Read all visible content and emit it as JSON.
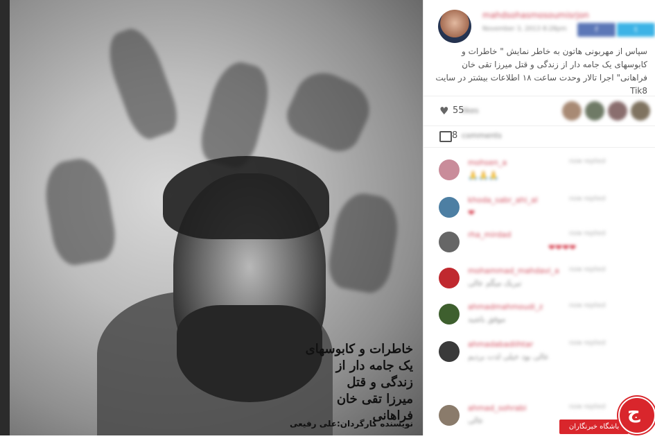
{
  "poster": {
    "title_lines": [
      "خاطرات و کابوسهای",
      "یک جامه دار از زندگی و قتل",
      "میرزا تقی خان فراهانی"
    ],
    "credit": "نویسنده کارگردان:علی رفیعی"
  },
  "post": {
    "username": "mahdsohasmosoumisrjon",
    "date": "November 3, 2013 8:28pm",
    "share_facebook": "f",
    "share_twitter": "t",
    "caption": "سپاس از مهربونی هاتون به خاطر نمایش \" خاطرات و کابوسهای یک جامه دار از زندگی و قتل میرزا تقی خان فراهانی\" اجرا تالار وحدت ساعت ۱۸ اطلاعات بیشتر در سایت Tik8",
    "likes_count": "55",
    "likes_label": "likes",
    "comments_count": "8",
    "comments_label": "comments"
  },
  "comments": [
    {
      "user": "mohsen_a",
      "time": "now replied",
      "text": "🙏🙏🙏",
      "avatar_color": "#c98c9a"
    },
    {
      "user": "khoda_sabr_ahi_al",
      "time": "now replied",
      "text": "❤",
      "avatar_color": "#4d7fa3"
    },
    {
      "user": "rha_mirdad",
      "time": "now replied",
      "text": "❤❤❤❤",
      "avatar_color": "#666666"
    },
    {
      "user": "mohammad_mahdavi_a",
      "time": "now replied",
      "text": "تبریک میگم عالی",
      "avatar_color": "#c0292f"
    },
    {
      "user": "ahmadmahmoudi_z",
      "time": "now replied",
      "text": "موفق باشید",
      "avatar_color": "#3e5f2e"
    },
    {
      "user": "ahmadabadiihtar",
      "time": "now replied",
      "text": "عالی بود خیلی لذت بردیم",
      "avatar_color": "#3a3a3a"
    },
    {
      "user": "ahmad_sohrabi",
      "time": "now replied",
      "text": "عالی",
      "avatar_color": "#8a7b6b"
    }
  ],
  "brand": {
    "label": "باشگاه خبرنگاران",
    "color": "#d9262c"
  }
}
